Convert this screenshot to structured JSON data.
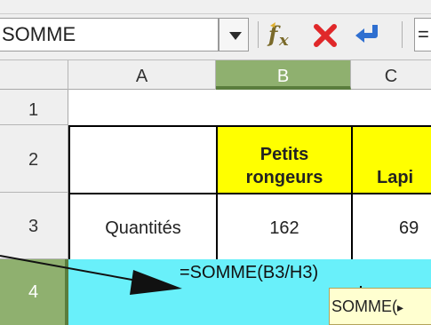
{
  "toolbar": {
    "name_box_value": "SOMME",
    "formula_input_peek": "="
  },
  "columns": [
    {
      "label": "A"
    },
    {
      "label": "B"
    },
    {
      "label": "C"
    }
  ],
  "rows": [
    {
      "label": "1"
    },
    {
      "label": "2"
    },
    {
      "label": "3"
    },
    {
      "label": "4"
    }
  ],
  "cells": {
    "B2_line1": "Petits",
    "B2_line2": "rongeurs",
    "C2_partial": "Lapi",
    "A3": "Quantités",
    "B3": "162",
    "C3": "69",
    "A4_formula": "=SOMME(B3/H3)"
  },
  "tooltip": {
    "text": "SOMME(",
    "arrow_glyph": "▸"
  },
  "colors": {
    "header_cells": "#ffff00",
    "active_row": "#69f0fa",
    "selected_header": "#8fb06f"
  }
}
